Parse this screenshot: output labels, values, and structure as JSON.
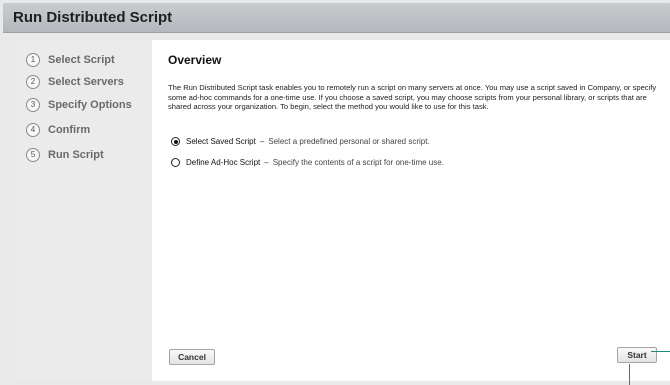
{
  "window": {
    "title": "Run Distributed Script"
  },
  "steps": [
    {
      "num": "1",
      "label": "Select Script"
    },
    {
      "num": "2",
      "label": "Select Servers"
    },
    {
      "num": "3",
      "label": "Specify Options"
    },
    {
      "num": "4",
      "label": "Confirm"
    },
    {
      "num": "5",
      "label": "Run Script"
    }
  ],
  "main": {
    "heading": "Overview",
    "description": "The Run Distributed Script task enables you to remotely run a script on many servers at once. You may use a script saved in Company, or specify some ad-hoc commands for a one-time use. If you choose a saved script, you may choose scripts from your personal library, or scripts that are shared across your organization. To begin, select the method you would like to use for this task.",
    "options": [
      {
        "label": "Select Saved Script",
        "separator": "–",
        "hint": "Select a predefined personal or shared script.",
        "checked": true
      },
      {
        "label": "Define Ad-Hoc Script",
        "separator": "–",
        "hint": "Specify the contents of a script for one-time use.",
        "checked": false
      }
    ]
  },
  "buttons": {
    "cancel": "Cancel",
    "start": "Start"
  }
}
